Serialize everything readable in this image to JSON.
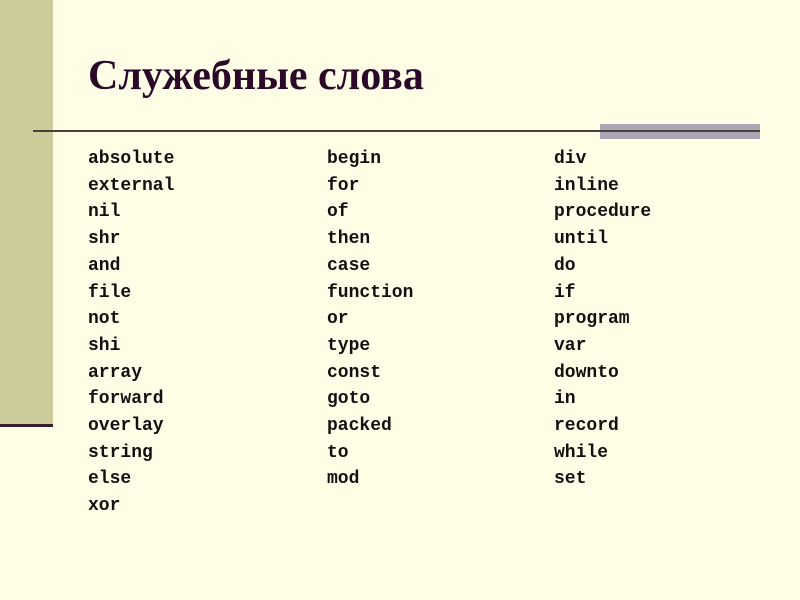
{
  "slide": {
    "title": "Служебные слова",
    "colors": {
      "background": "#fffde6",
      "sidebar": "#cccc9a",
      "accent_line": "#3a1a30",
      "title": "#2a0a28",
      "grey_bar": "#aba6b4"
    },
    "columns": [
      [
        "absolute",
        "external",
        "nil",
        "shr",
        "and",
        "file",
        "not",
        "shi",
        "array",
        "forward",
        "overlay",
        "string",
        "else",
        "xor"
      ],
      [
        "begin",
        "for",
        "of",
        "then",
        "case",
        "function",
        "or",
        "type",
        "const",
        "goto",
        "packed",
        "to",
        "mod"
      ],
      [
        "div",
        "inline",
        "procedure",
        "until",
        "do",
        "if",
        "program",
        "var",
        "downto",
        "in",
        "record",
        "while",
        "set"
      ]
    ]
  }
}
